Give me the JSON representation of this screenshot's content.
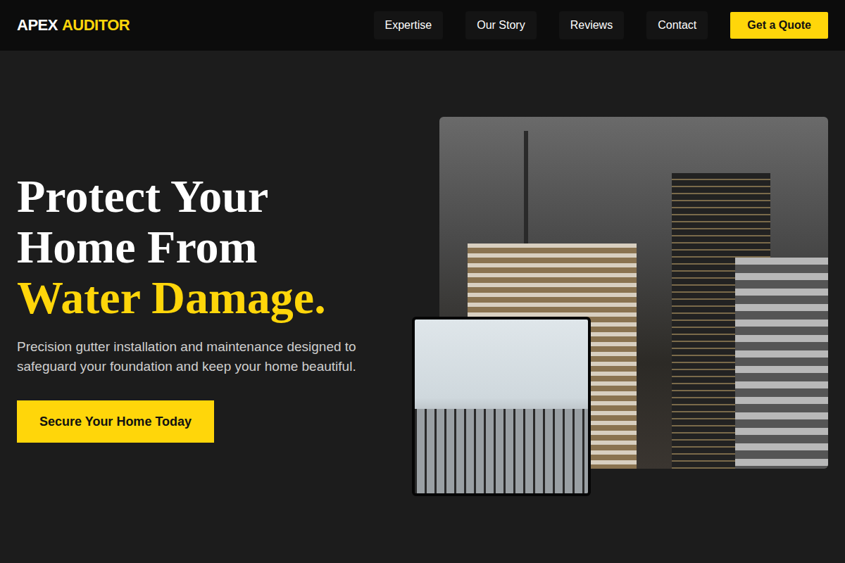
{
  "brand": {
    "first": "APEX",
    "second": "AUDITOR"
  },
  "nav": [
    {
      "label": "Expertise"
    },
    {
      "label": "Our Story"
    },
    {
      "label": "Reviews"
    },
    {
      "label": "Contact"
    }
  ],
  "nav_cta": "Get a Quote",
  "hero": {
    "title_lines": [
      "Protect Your",
      "Home From"
    ],
    "title_accent": "Water Damage.",
    "subtitle": "Precision gutter installation and maintenance designed to safeguard your foundation and keep your home beautiful.",
    "cta": "Secure Your Home Today"
  }
}
